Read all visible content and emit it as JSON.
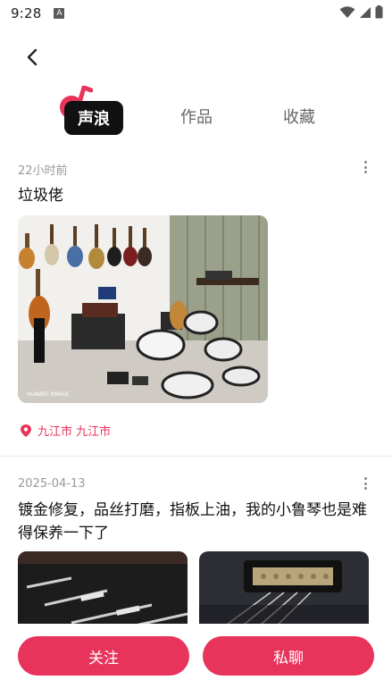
{
  "status_bar": {
    "time": "9:28",
    "notification": "A"
  },
  "tabs": [
    {
      "label": "声浪"
    },
    {
      "label": "作品"
    },
    {
      "label": "收藏"
    }
  ],
  "posts": [
    {
      "time": "22小时前",
      "text": "垃圾佬",
      "location": "九江市 九江市",
      "watermark": "HUAWEI XMAGE"
    },
    {
      "time": "2025-04-13",
      "text": "镀金修复，品丝打磨，指板上油，我的小鲁琴也是难得保养一下了"
    }
  ],
  "actions": {
    "follow_label": "关注",
    "chat_label": "私聊"
  },
  "colors": {
    "accent": "#e8335a",
    "tab_active_bg": "#111111"
  }
}
